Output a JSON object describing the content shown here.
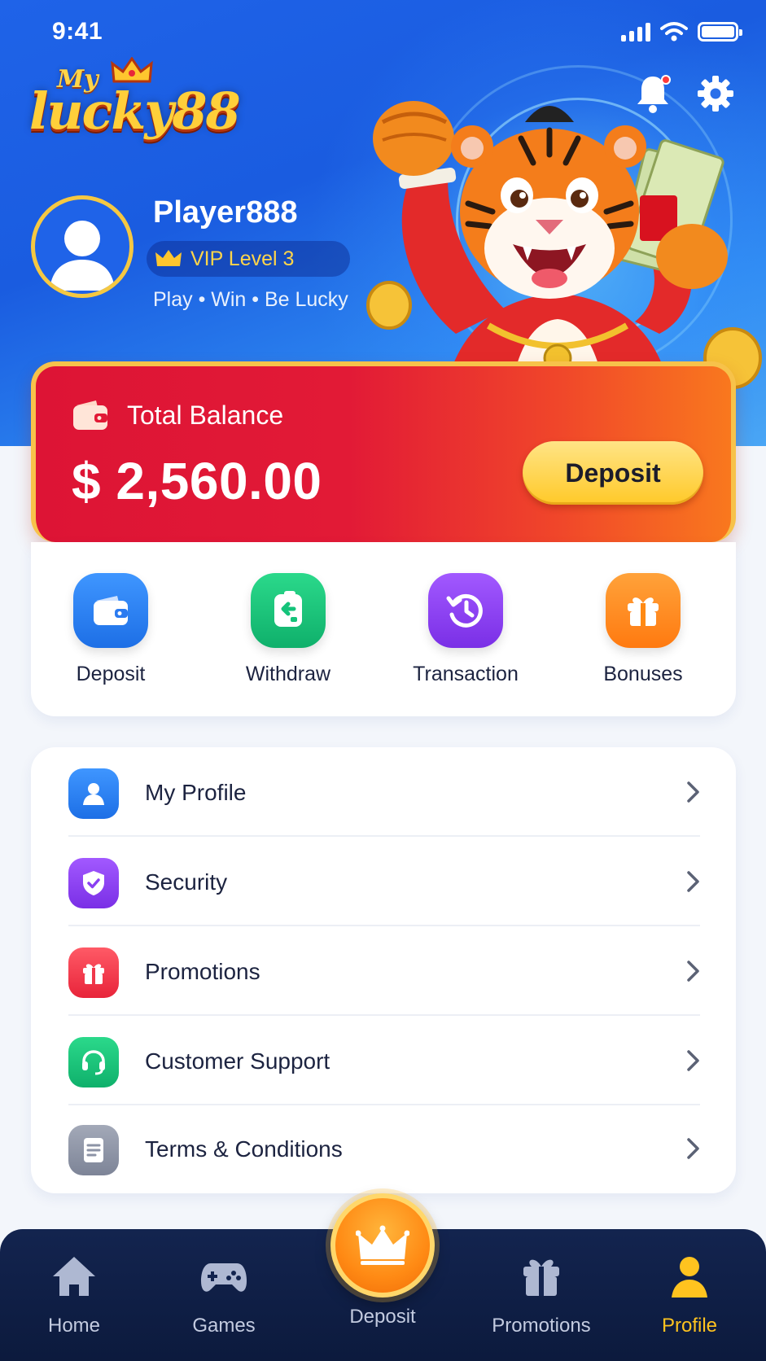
{
  "status_bar": {
    "time": "9:41"
  },
  "brand": {
    "logo_small": "My",
    "logo_main": "lucky88"
  },
  "profile": {
    "name": "Player888",
    "vip": "VIP Level 3",
    "tagline": "Play • Win • Be Lucky"
  },
  "balance": {
    "label": "Total Balance",
    "amount": "$ 2,560.00",
    "deposit_label": "Deposit"
  },
  "quick_actions": [
    {
      "label": "Deposit",
      "icon": "wallet-icon",
      "color": "#2b7bf0"
    },
    {
      "label": "Withdraw",
      "icon": "withdraw-icon",
      "color": "#14c37a"
    },
    {
      "label": "Transaction",
      "icon": "history-icon",
      "color": "#8a3ff2"
    },
    {
      "label": "Bonuses",
      "icon": "gift-icon",
      "color": "#ff8a14"
    }
  ],
  "menu": [
    {
      "label": "My Profile",
      "icon": "user-icon",
      "color": "#2b7bf0"
    },
    {
      "label": "Security",
      "icon": "shield-icon",
      "color": "#8a3ff2"
    },
    {
      "label": "Promotions",
      "icon": "gift-icon",
      "color": "#f0384a"
    },
    {
      "label": "Customer Support",
      "icon": "headset-icon",
      "color": "#14c37a"
    },
    {
      "label": "Terms & Conditions",
      "icon": "document-icon",
      "color": "#8c93a6"
    }
  ],
  "bottom_nav": [
    {
      "label": "Home",
      "icon": "home-icon"
    },
    {
      "label": "Games",
      "icon": "gamepad-icon"
    },
    {
      "label": "Deposit",
      "icon": "crown-icon"
    },
    {
      "label": "Promotions",
      "icon": "gift-icon"
    },
    {
      "label": "Profile",
      "icon": "profile-icon",
      "active": true
    }
  ],
  "colors": {
    "accent": "#ffc31f",
    "balance_red": "#e21a36",
    "nav_bg": "#0c1a3d"
  }
}
